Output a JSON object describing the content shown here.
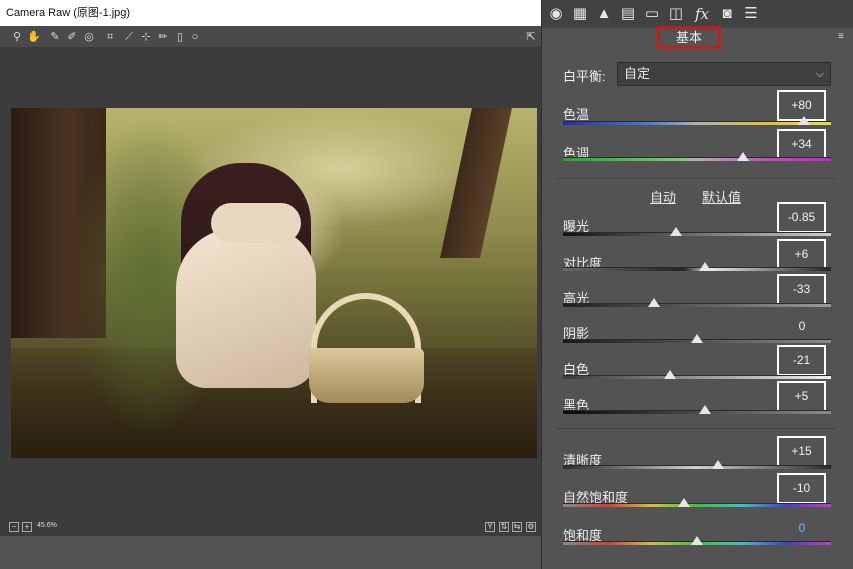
{
  "window": {
    "title": "Camera Raw (原图-1.jpg)"
  },
  "toolbar": {
    "tools": [
      "zoom-icon",
      "hand-icon",
      "eyedropper-icon",
      "color-sampler-icon",
      "target-adjust-icon",
      "crop-icon",
      "straighten-icon",
      "spot-removal-icon",
      "brush-icon",
      "filter-icon",
      "circle-icon"
    ]
  },
  "status": {
    "zoom": "45.6%"
  },
  "tabs": [
    "aperture-icon",
    "curve-icon",
    "mountain-icon",
    "hsl-icon",
    "split-tone-icon",
    "lens-icon",
    "fx-icon",
    "camera-icon",
    "sliders-icon"
  ],
  "panel": {
    "title": "基本",
    "white_balance": {
      "label": "白平衡:",
      "value": "自定"
    },
    "auto_label": "自动",
    "default_label": "默认值",
    "sliders": [
      {
        "id": "temperature",
        "label": "色温",
        "value": "+80",
        "pos": 0.9,
        "boxed": true,
        "gradient": "linear-gradient(90deg,#2a2aa8,#3c78d8 30%,#b0b0b0 50%,#d8c43c 75%,#e8e03a)"
      },
      {
        "id": "tint",
        "label": "色调",
        "value": "+34",
        "pos": 0.67,
        "boxed": true,
        "gradient": "linear-gradient(90deg,#22aa22,#66cc66 40%,#b0b0b0 50%,#c050c0 75%,#d020d0)"
      },
      {
        "id": "exposure",
        "label": "曝光",
        "value": "-0.85",
        "pos": 0.42,
        "boxed": true,
        "gradient": "linear-gradient(90deg,#111,#cfcfcf)"
      },
      {
        "id": "contrast",
        "label": "对比度",
        "value": "+6",
        "pos": 0.53,
        "boxed": true,
        "gradient": "linear-gradient(90deg,#6a6a6a,#222 45%,#e8e8e8 55%,#222)"
      },
      {
        "id": "highlights",
        "label": "高光",
        "value": "-33",
        "pos": 0.34,
        "boxed": true,
        "gradient": "linear-gradient(90deg,#202020,#9a9a9a)"
      },
      {
        "id": "shadows",
        "label": "阴影",
        "value": "0",
        "pos": 0.5,
        "boxed": false,
        "gradient": "linear-gradient(90deg,#1a1a1a,#8a8a8a)"
      },
      {
        "id": "whites",
        "label": "白色",
        "value": "-21",
        "pos": 0.4,
        "boxed": true,
        "gradient": "linear-gradient(90deg,#3a3a3a,#f0f0f0)"
      },
      {
        "id": "blacks",
        "label": "黑色",
        "value": "+5",
        "pos": 0.53,
        "boxed": true,
        "gradient": "linear-gradient(90deg,#0a0a0a,#8a8a8a)"
      },
      {
        "id": "clarity",
        "label": "清晰度",
        "value": "+15",
        "pos": 0.58,
        "boxed": true,
        "gradient": "linear-gradient(90deg,#2a2a2a,#d0d0d0 50%,#2a2a2a)"
      },
      {
        "id": "vibrance",
        "label": "自然饱和度",
        "value": "-10",
        "pos": 0.45,
        "boxed": true,
        "gradient": "linear-gradient(90deg,#888,#d04040,#d0c040,#40c040,#40c0c0,#4040d0,#c040c0)"
      },
      {
        "id": "saturation",
        "label": "饱和度",
        "value": "0",
        "pos": 0.5,
        "boxed": false,
        "gradient": "linear-gradient(90deg,#888,#d04040,#d0c040,#40c040,#40c0c0,#4040d0,#c040c0)"
      }
    ]
  }
}
